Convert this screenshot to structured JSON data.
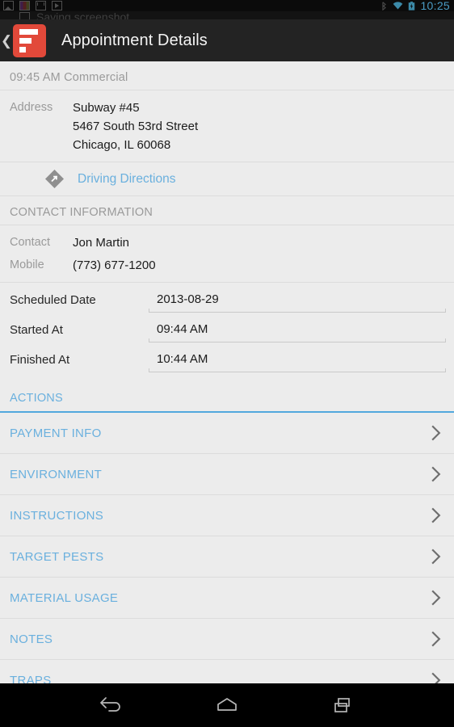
{
  "statusbar": {
    "notification_icons": [
      "photo-icon",
      "gallery-icon",
      "mail-icon",
      "play-icon"
    ],
    "bluetooth_icon": "bluetooth-icon",
    "wifi_icon": "wifi-icon",
    "battery_icon": "battery-icon",
    "time": "10:25",
    "clock_color": "#4a9bc4"
  },
  "notification_shade": {
    "item_text": "Saving screenshot..."
  },
  "actionbar": {
    "back_icon": "back-chevron-icon",
    "logo_icon": "app-logo-icon",
    "title": "Appointment Details",
    "background": "#232323",
    "logo_color": "#e2493a"
  },
  "appointment": {
    "summary": "09:45 AM Commercial",
    "address_label": "Address",
    "address_lines": [
      "Subway #45",
      "5467 South 53rd Street",
      "Chicago, IL 60068"
    ],
    "directions_icon": "navigation-diamond-icon",
    "directions_label": "Driving Directions",
    "link_color": "#6ab0de"
  },
  "contact": {
    "section_title": "CONTACT INFORMATION",
    "rows": [
      {
        "label": "Contact",
        "value": "Jon Martin"
      },
      {
        "label": "Mobile",
        "value": "(773) 677-1200"
      }
    ]
  },
  "fields": [
    {
      "label": "Scheduled Date",
      "value": "2013-08-29",
      "placeholder": "Scheduled Date"
    },
    {
      "label": "Started At",
      "value": "09:44 AM",
      "placeholder": "Started At"
    },
    {
      "label": "Finished At",
      "value": "10:44 AM",
      "placeholder": "Finished At"
    }
  ],
  "actions": {
    "section_title": "ACTIONS",
    "accent_color": "#52a8dd",
    "items": [
      {
        "label": "PAYMENT INFO",
        "chevron": "chevron-right-icon"
      },
      {
        "label": "ENVIRONMENT",
        "chevron": "chevron-right-icon"
      },
      {
        "label": "INSTRUCTIONS",
        "chevron": "chevron-right-icon"
      },
      {
        "label": "TARGET PESTS",
        "chevron": "chevron-right-icon"
      },
      {
        "label": "MATERIAL USAGE",
        "chevron": "chevron-right-icon"
      },
      {
        "label": "NOTES",
        "chevron": "chevron-right-icon"
      },
      {
        "label": "TRAPS",
        "chevron": "chevron-right-icon"
      }
    ]
  },
  "navbar": {
    "back_icon": "nav-back-icon",
    "home_icon": "nav-home-icon",
    "recents_icon": "nav-recents-icon"
  }
}
